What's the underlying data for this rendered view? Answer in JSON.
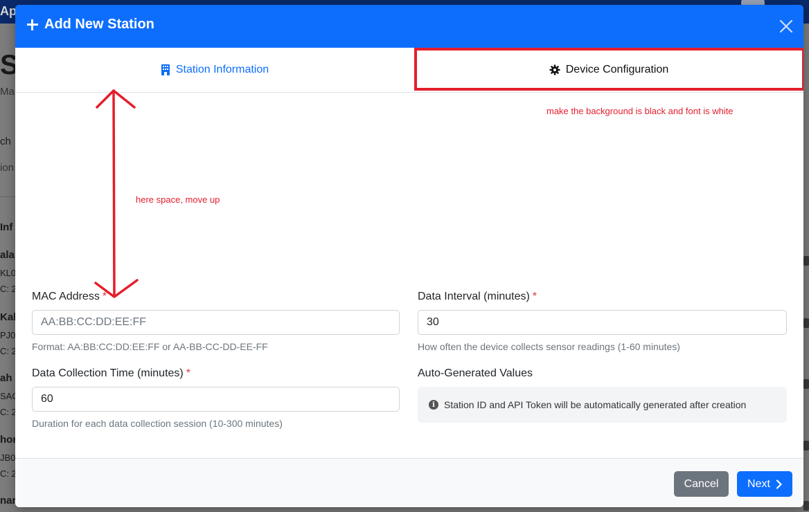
{
  "background": {
    "brand_fragment": "Ap",
    "left_fragments": [
      "S",
      "Ma",
      "ch",
      "ion",
      "Inf",
      "ala",
      "KL0",
      "C: 2",
      "Kali",
      "PJ0",
      "C: 2",
      "ah A",
      "SAC",
      "C: 2",
      "hor",
      "JB0",
      "C: 2",
      "nar"
    ]
  },
  "modal": {
    "title": "Add New Station",
    "tabs": [
      {
        "label": "Station Information",
        "icon": "building-icon",
        "active": true
      },
      {
        "label": "Device Configuration",
        "icon": "gear-icon",
        "active": false
      }
    ]
  },
  "annotations": {
    "tab_note": "make the background is black and font is white",
    "space_note": "here space, move up"
  },
  "form": {
    "mac": {
      "label": "MAC Address",
      "required": "*",
      "placeholder": "AA:BB:CC:DD:EE:FF",
      "help": "Format: AA:BB:CC:DD:EE:FF or AA-BB-CC-DD-EE-FF"
    },
    "interval": {
      "label": "Data Interval (minutes)",
      "required": "*",
      "value": "30",
      "help": "How often the device collects sensor readings (1-60 minutes)"
    },
    "collection": {
      "label": "Data Collection Time (minutes)",
      "required": "*",
      "value": "60",
      "help": "Duration for each data collection session (10-300 minutes)"
    },
    "auto": {
      "label": "Auto-Generated Values",
      "info": "Station ID and API Token will be automatically generated after creation"
    }
  },
  "footer": {
    "cancel_label": "Cancel",
    "next_label": "Next"
  },
  "colors": {
    "primary": "#0d6efd",
    "annotation_red": "#e41e2b",
    "required": "#dc3545",
    "secondary": "#6c757d"
  }
}
